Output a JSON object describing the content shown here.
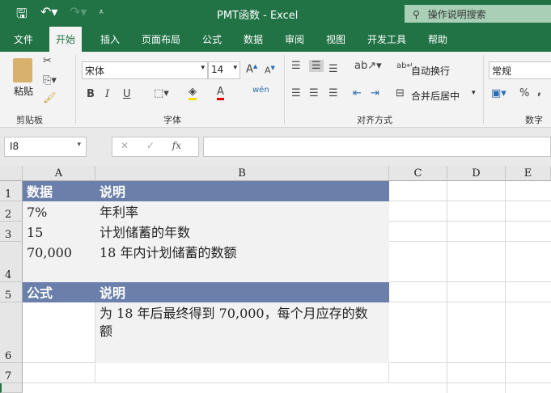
{
  "title": "PMT函数  -  Excel",
  "search_placeholder": "操作说明搜索",
  "tabs": [
    "文件",
    "开始",
    "插入",
    "页面布局",
    "公式",
    "数据",
    "审阅",
    "视图",
    "开发工具",
    "帮助"
  ],
  "ribbon": {
    "paste": "粘贴",
    "clipboard": "剪贴板",
    "font_name": "宋体",
    "font_size": "14",
    "font_group": "字体",
    "wrap": "自动换行",
    "merge": "合并后居中",
    "align_group": "对齐方式",
    "number_format": "常规",
    "number_group": "数字",
    "bold": "B",
    "italic": "I",
    "underline": "U",
    "percent": "%"
  },
  "name_box": "I8",
  "columns": [
    "A",
    "B",
    "C",
    "D",
    "E"
  ],
  "rows": [
    "1",
    "2",
    "3",
    "4",
    "5",
    "6",
    "7"
  ],
  "cells": {
    "A1": "数据",
    "B1": "说明",
    "A2": "7%",
    "B2": "年利率",
    "A3": "15",
    "B3": "计划储蓄的年数",
    "A4": "70,000",
    "B4": "18 年内计划储蓄的数额",
    "A5": "公式",
    "B5": "说明",
    "B6": "为 18 年后最终得到 70,000，每个月应存的数额"
  },
  "colors": {
    "brand": "#217346",
    "header_fill": "#6a7faa",
    "data_fill": "#f2f2f2"
  }
}
